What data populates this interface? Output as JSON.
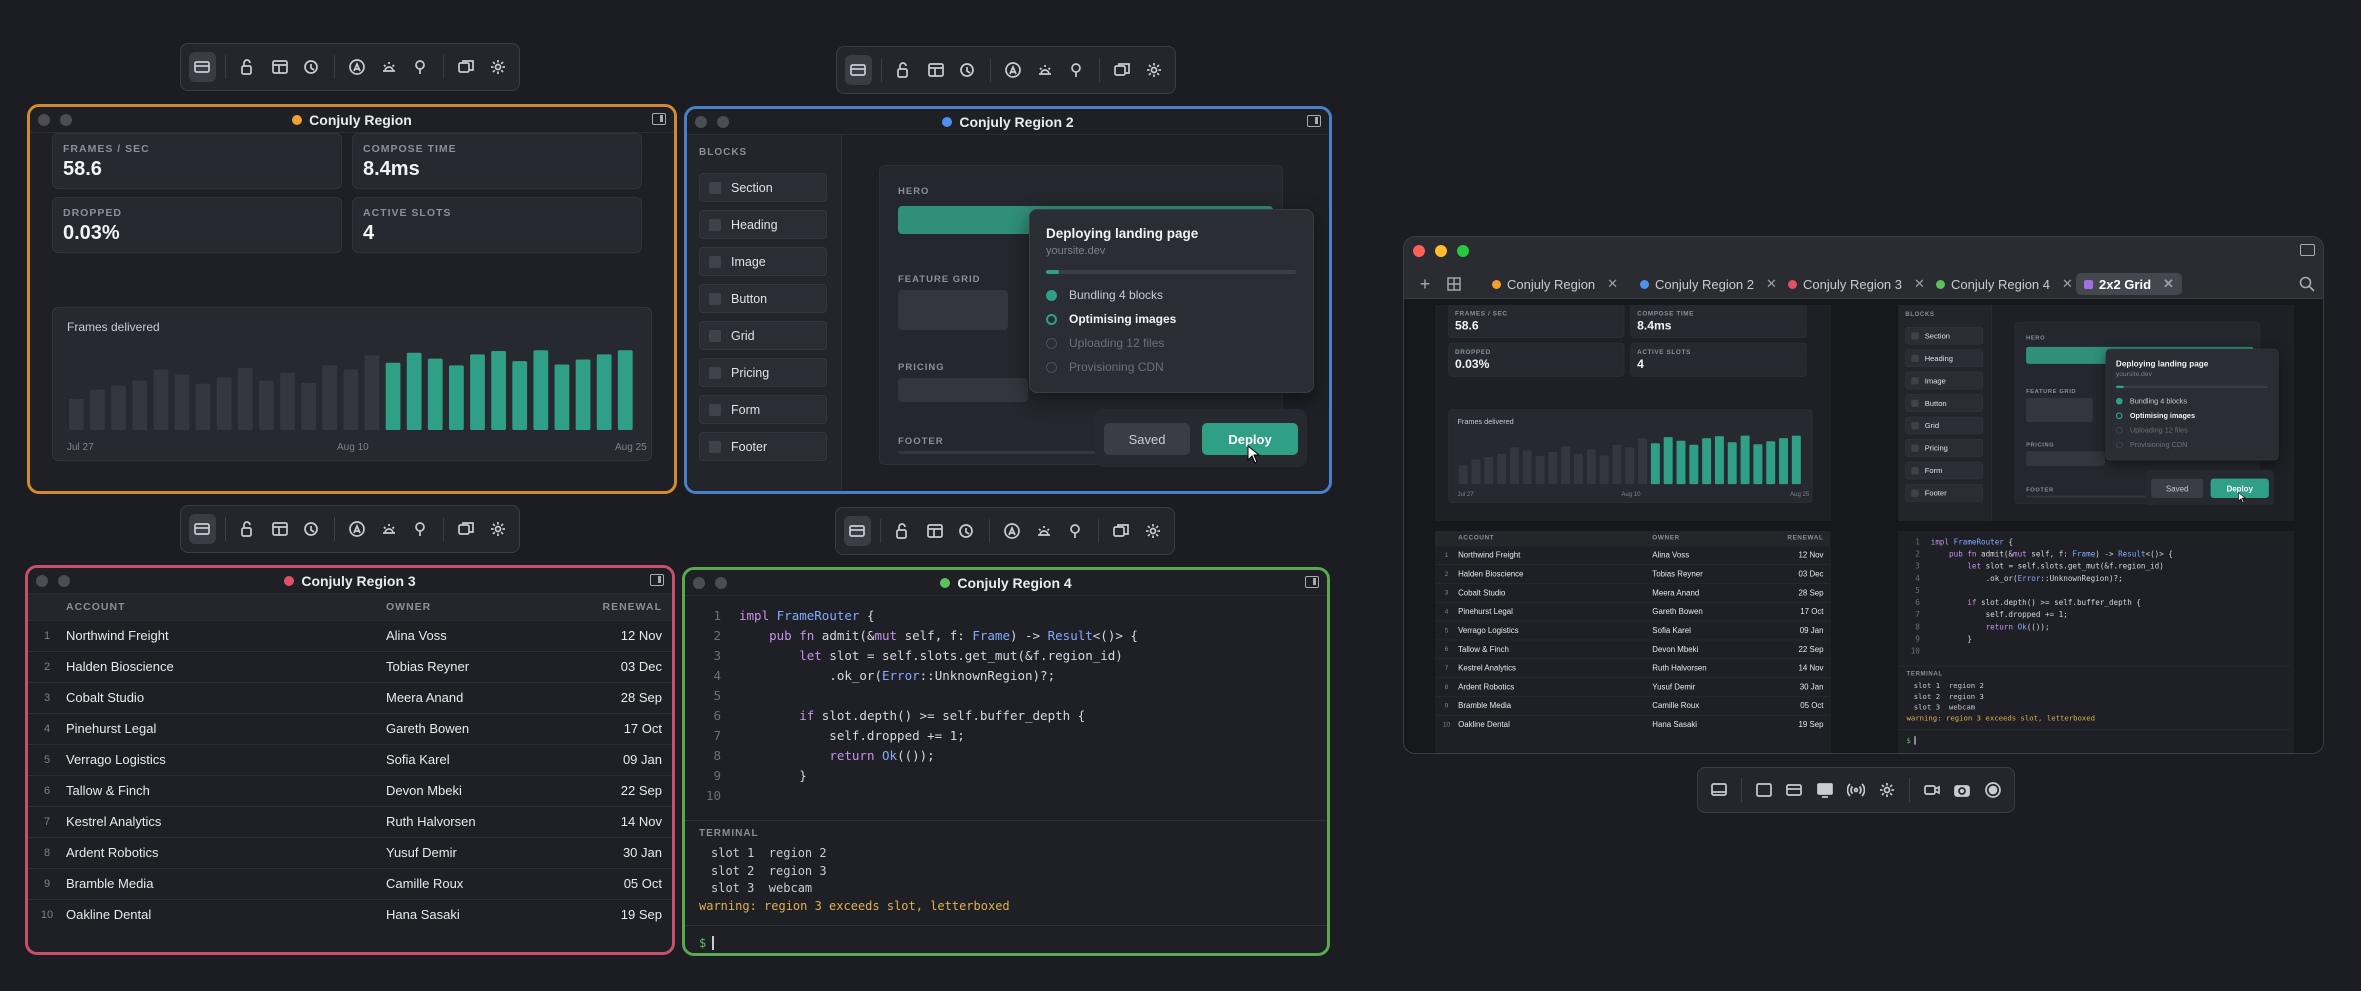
{
  "toolbar_icons": [
    "region-icon",
    "unlock-icon",
    "layout-icon",
    "touch-icon",
    "accessibility-icon",
    "brightness-icon",
    "pin-icon",
    "duplicate-icon",
    "gear-icon"
  ],
  "region1": {
    "title": "Conjuly Region",
    "color": "#f0a030",
    "stats": [
      {
        "label": "FRAMES / SEC",
        "value": "58.6"
      },
      {
        "label": "COMPOSE TIME",
        "value": "8.4ms"
      },
      {
        "label": "DROPPED",
        "value": "0.03%"
      },
      {
        "label": "ACTIVE SLOTS",
        "value": "4"
      }
    ],
    "chart_title": "Frames delivered",
    "x_labels": [
      "Jul 27",
      "Aug 10",
      "Aug 25"
    ]
  },
  "chart_data": {
    "type": "bar",
    "title": "Frames delivered",
    "categories": [
      "Jul 27",
      "",
      "",
      "",
      "",
      "",
      "",
      "",
      "",
      "",
      "",
      "",
      "",
      "",
      "",
      "",
      "",
      "",
      "",
      "",
      "",
      "",
      "",
      "",
      "",
      "",
      "",
      "Aug 10",
      "",
      "",
      "Aug 25"
    ],
    "values": [
      0.37,
      0.48,
      0.53,
      0.59,
      0.72,
      0.66,
      0.55,
      0.63,
      0.74,
      0.59,
      0.68,
      0.56,
      0.77,
      0.72,
      0.89,
      0.8,
      0.92,
      0.85,
      0.77,
      0.9,
      0.94,
      0.82,
      0.95,
      0.78,
      0.84,
      0.9,
      0.95
    ],
    "highlight_from": 15
  },
  "region2": {
    "title": "Conjuly Region 2",
    "color": "#4f8ff0",
    "blocks_header": "BLOCKS",
    "blocks": [
      "Section",
      "Heading",
      "Image",
      "Button",
      "Grid",
      "Pricing",
      "Form",
      "Footer"
    ],
    "canvas_labels": {
      "hero": "HERO",
      "feature": "FEATURE GRID",
      "pricing": "PRICING",
      "footer": "FOOTER"
    },
    "deploy": {
      "title": "Deploying landing page",
      "site": "yoursite.dev",
      "progress": 0.05,
      "steps": [
        {
          "label": "Bundling 4 blocks",
          "state": "done"
        },
        {
          "label": "Optimising images",
          "state": "active"
        },
        {
          "label": "Uploading 12 files",
          "state": "pending"
        },
        {
          "label": "Provisioning CDN",
          "state": "pending"
        }
      ],
      "saved": "Saved",
      "deploy": "Deploy"
    }
  },
  "region3": {
    "title": "Conjuly Region 3",
    "color": "#e0506a",
    "columns": [
      "",
      "ACCOUNT",
      "OWNER",
      "RENEWAL"
    ],
    "rows": [
      [
        "1",
        "Northwind Freight",
        "Alina Voss",
        "12 Nov"
      ],
      [
        "2",
        "Halden Bioscience",
        "Tobias Reyner",
        "03 Dec"
      ],
      [
        "3",
        "Cobalt Studio",
        "Meera Anand",
        "28 Sep"
      ],
      [
        "4",
        "Pinehurst Legal",
        "Gareth Bowen",
        "17 Oct"
      ],
      [
        "5",
        "Verrago Logistics",
        "Sofia Karel",
        "09 Jan"
      ],
      [
        "6",
        "Tallow & Finch",
        "Devon Mbeki",
        "22 Sep"
      ],
      [
        "7",
        "Kestrel Analytics",
        "Ruth Halvorsen",
        "14 Nov"
      ],
      [
        "8",
        "Ardent Robotics",
        "Yusuf Demir",
        "30 Jan"
      ],
      [
        "9",
        "Bramble Media",
        "Camille Roux",
        "05 Oct"
      ],
      [
        "10",
        "Oakline Dental",
        "Hana Sasaki",
        "19 Sep"
      ]
    ]
  },
  "region4": {
    "title": "Conjuly Region 4",
    "color": "#5cc05c",
    "code": [
      "impl FrameRouter {",
      "    pub fn admit(&mut self, f: Frame) -> Result<()> {",
      "        let slot = self.slots.get_mut(&f.region_id)",
      "            .ok_or(Error::UnknownRegion)?;",
      "",
      "        if slot.depth() >= self.buffer_depth {",
      "            self.dropped += 1;",
      "            return Ok(());",
      "        }",
      ""
    ],
    "terminal_label": "TERMINAL",
    "terminal": [
      "slot 1  region 2",
      "slot 2  region 3",
      "slot 3  webcam"
    ],
    "warning": "warning: region 3 exceeds slot, letterboxed",
    "prompt": "$"
  },
  "browser": {
    "tabs": [
      {
        "label": "Conjuly Region",
        "color": "#f0a030"
      },
      {
        "label": "Conjuly Region 2",
        "color": "#4f8ff0"
      },
      {
        "label": "Conjuly Region 3",
        "color": "#e0506a"
      },
      {
        "label": "Conjuly Region 4",
        "color": "#5cc05c"
      },
      {
        "label": "2x2 Grid",
        "color": "#a070e0"
      }
    ]
  },
  "bottom_toolbar_icons": [
    "screen-icon",
    "window-icon",
    "region-icon",
    "display-icon",
    "broadcast-icon",
    "gear-icon",
    "camera-off-icon",
    "camera-icon",
    "record-icon"
  ]
}
